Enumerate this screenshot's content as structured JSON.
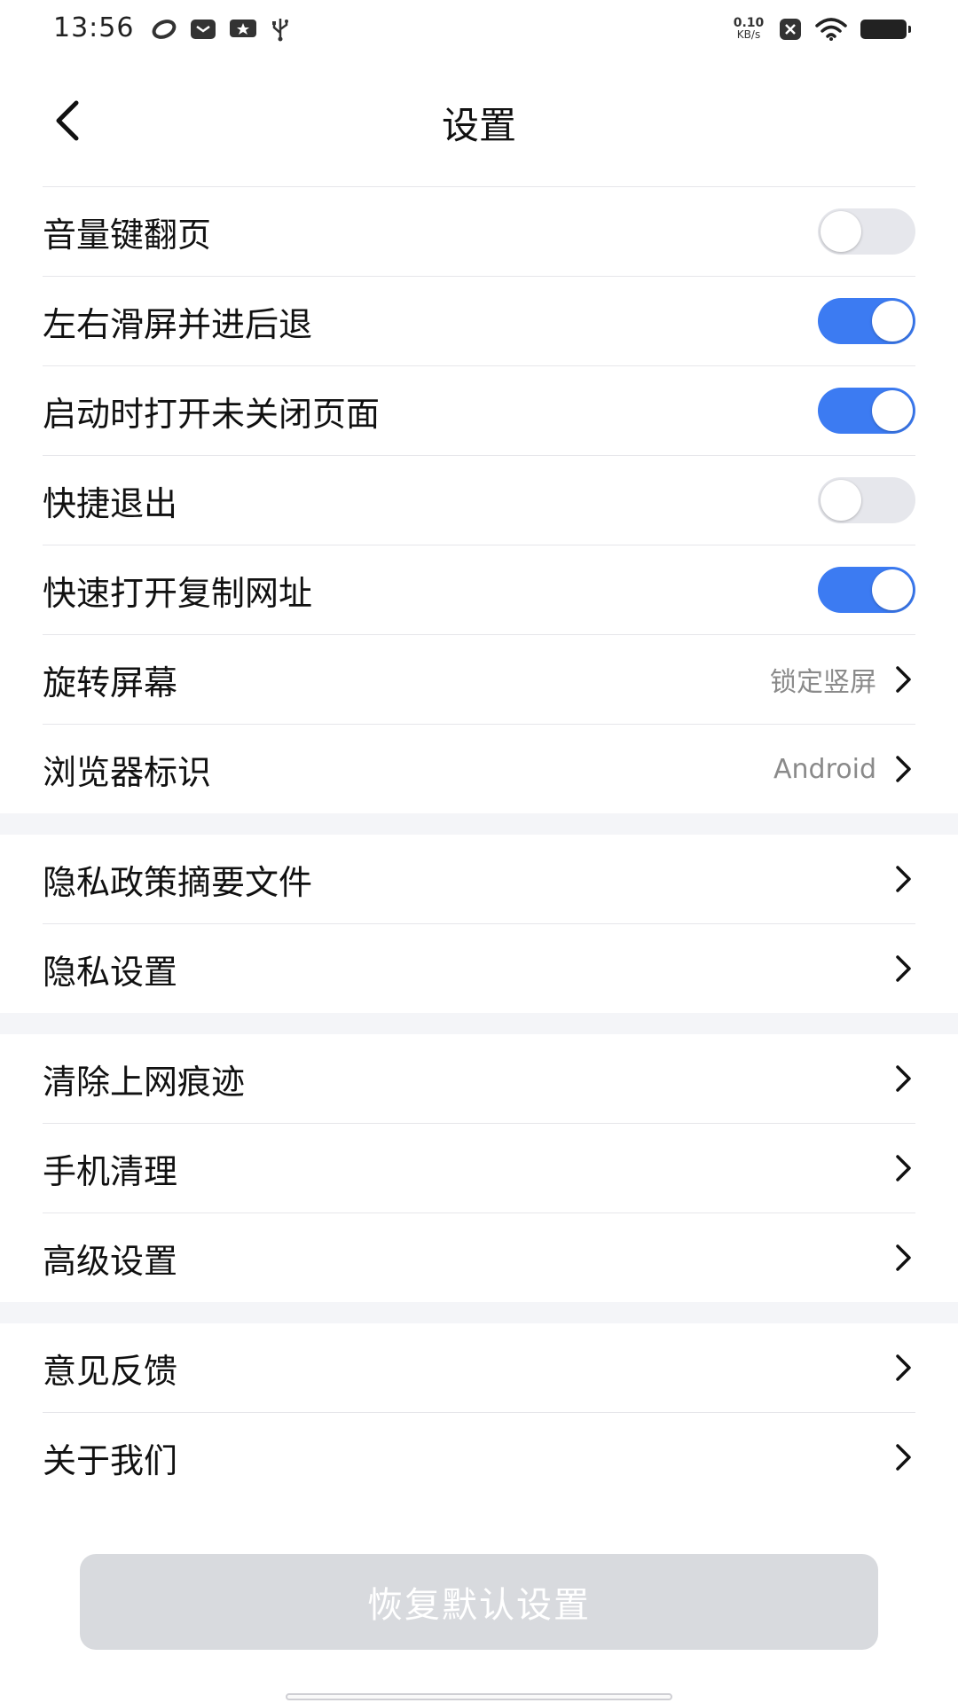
{
  "status_bar": {
    "time": "13:56",
    "net_speed_value": "0.10",
    "net_speed_unit": "KB/s",
    "left_icons": [
      "swirl-icon",
      "mail-icon",
      "star-card-icon",
      "usb-icon"
    ],
    "right_icons": [
      "close-notification-icon",
      "wifi-icon",
      "battery-icon"
    ]
  },
  "header": {
    "title": "设置"
  },
  "groups": [
    {
      "items": [
        {
          "label": "音量键翻页",
          "type": "toggle",
          "on": false
        },
        {
          "label": "左右滑屏并进后退",
          "type": "toggle",
          "on": true
        },
        {
          "label": "启动时打开未关闭页面",
          "type": "toggle",
          "on": true
        },
        {
          "label": "快捷退出",
          "type": "toggle",
          "on": false
        },
        {
          "label": "快速打开复制网址",
          "type": "toggle",
          "on": true
        },
        {
          "label": "旋转屏幕",
          "type": "link",
          "value": "锁定竖屏"
        },
        {
          "label": "浏览器标识",
          "type": "link",
          "value": "Android"
        }
      ]
    },
    {
      "items": [
        {
          "label": "隐私政策摘要文件",
          "type": "link"
        },
        {
          "label": "隐私设置",
          "type": "link"
        }
      ]
    },
    {
      "items": [
        {
          "label": "清除上网痕迹",
          "type": "link"
        },
        {
          "label": "手机清理",
          "type": "link"
        },
        {
          "label": "高级设置",
          "type": "link"
        }
      ]
    },
    {
      "items": [
        {
          "label": "意见反馈",
          "type": "link"
        },
        {
          "label": "关于我们",
          "type": "link"
        }
      ]
    }
  ],
  "reset_button": {
    "label": "恢复默认设置"
  },
  "colors": {
    "toggle_on": "#3c7bf2",
    "toggle_off": "#e6e7ec",
    "section_gap": "#f4f5f8",
    "reset_button_bg": "#d8dade"
  }
}
